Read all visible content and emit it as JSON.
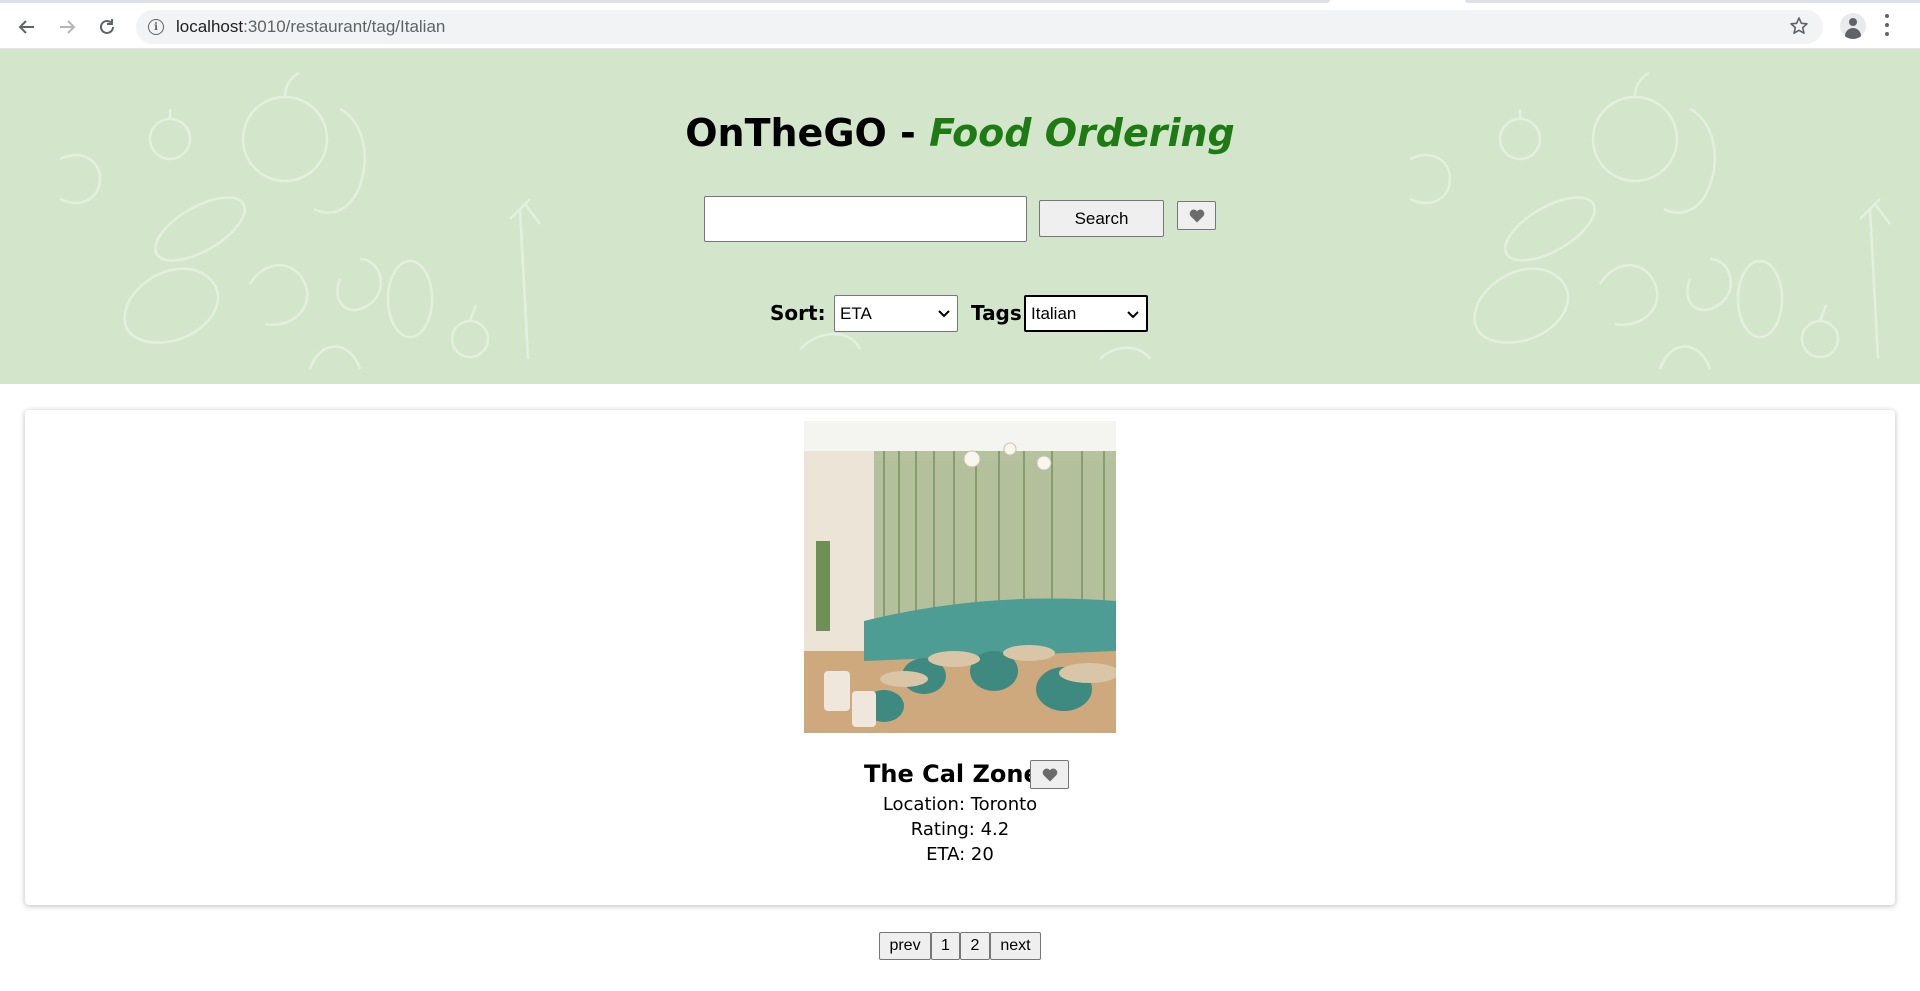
{
  "browser": {
    "url_host": "localhost",
    "url_path": ":3010/restaurant/tag/Italian"
  },
  "header": {
    "title_main": "OnTheGO -",
    "title_accent": "Food Ordering",
    "search": {
      "value": "",
      "placeholder": "",
      "button_label": "Search"
    },
    "sort": {
      "label": "Sort:",
      "selected": "ETA"
    },
    "tags": {
      "label": "Tags:",
      "selected": "Italian"
    }
  },
  "restaurant": {
    "name": "The Cal Zone",
    "location": "Location: Toronto",
    "rating": "Rating: 4.2",
    "eta": "ETA: 20"
  },
  "pagination": {
    "prev_label": "prev",
    "pages": [
      "1",
      "2"
    ],
    "next_label": "next"
  },
  "colors": {
    "hero_background": "#d3e6cb",
    "title_accent": "#1e7a12"
  },
  "icons": {
    "favorite": "heart-icon",
    "back": "arrow-left-icon",
    "forward": "arrow-right-icon",
    "reload": "reload-icon",
    "site_info": "info-icon",
    "bookmark": "star-icon",
    "profile": "profile-icon",
    "menu": "kebab-menu-icon"
  }
}
